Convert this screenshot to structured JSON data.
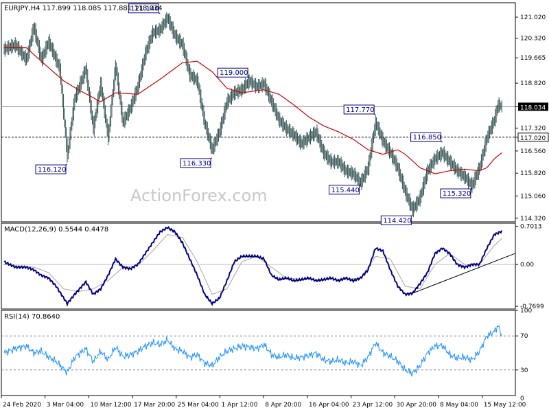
{
  "header": {
    "symbol_line": "EURJPY,H4  117.899 118.085 117.881 118.034",
    "macd_line": "MACD(12,26,9) 0.5544 0.4478",
    "rsi_line": "RSI(14) 70.8640"
  },
  "watermark": "ActionForex.com",
  "colors": {
    "candles": "#2f4f4f",
    "moving_average": "#cc0000",
    "macd": "#000080",
    "signal": "#b0a0a0",
    "rsi": "#1e90ff",
    "last_price_box": "#000000"
  },
  "chart_data": [
    {
      "type": "candlestick",
      "panel": "price",
      "ylim": [
        114.2,
        121.5
      ],
      "yticks": [
        "121.020",
        "120.320",
        "119.665",
        "118.820",
        "118.034",
        "117.320",
        "117.020",
        "116.560",
        "115.820",
        "115.060",
        "114.320"
      ],
      "x_labels": [
        "24 Feb 2020",
        "3 Mar 04:00",
        "10 Mar 12:00",
        "17 Mar 20:00",
        "25 Mar 04:00",
        "1 Apr 12:00",
        "8 Apr 20:00",
        "16 Apr 04:00",
        "23 Apr 12:00",
        "30 Apr 20:00",
        "8 May 04:00",
        "15 May 12:00"
      ],
      "close_path": [
        [
          0,
          119.95
        ],
        [
          3,
          120.1
        ],
        [
          6,
          119.6
        ],
        [
          8,
          120.7
        ],
        [
          10,
          119.6
        ],
        [
          12,
          120.2
        ],
        [
          15,
          119.3
        ],
        [
          17,
          116.4
        ],
        [
          19,
          118.3
        ],
        [
          22,
          119.3
        ],
        [
          24,
          117.3
        ],
        [
          26,
          118.8
        ],
        [
          28,
          117.0
        ],
        [
          30,
          119.4
        ],
        [
          32,
          117.5
        ],
        [
          34,
          118.0
        ],
        [
          36,
          118.7
        ],
        [
          38,
          119.8
        ],
        [
          40,
          120.5
        ],
        [
          42,
          120.6
        ],
        [
          44,
          121.0
        ],
        [
          46,
          120.4
        ],
        [
          48,
          120.1
        ],
        [
          50,
          119.1
        ],
        [
          52,
          118.9
        ],
        [
          54,
          117.5
        ],
        [
          56,
          116.6
        ],
        [
          58,
          117.2
        ],
        [
          60,
          118.2
        ],
        [
          62,
          118.5
        ],
        [
          64,
          118.6
        ],
        [
          66,
          118.9
        ],
        [
          68,
          118.7
        ],
        [
          70,
          118.8
        ],
        [
          72,
          118.2
        ],
        [
          74,
          117.6
        ],
        [
          76,
          117.3
        ],
        [
          78,
          117.1
        ],
        [
          80,
          116.8
        ],
        [
          82,
          117.0
        ],
        [
          84,
          117.2
        ],
        [
          86,
          116.5
        ],
        [
          88,
          116.2
        ],
        [
          90,
          116.2
        ],
        [
          92,
          115.9
        ],
        [
          94,
          115.8
        ],
        [
          96,
          115.5
        ],
        [
          98,
          116.0
        ],
        [
          100,
          117.5
        ],
        [
          102,
          116.9
        ],
        [
          104,
          116.5
        ],
        [
          106,
          116.0
        ],
        [
          108,
          115.2
        ],
        [
          110,
          114.6
        ],
        [
          112,
          115.0
        ],
        [
          114,
          115.9
        ],
        [
          116,
          116.3
        ],
        [
          118,
          116.5
        ],
        [
          120,
          116.2
        ],
        [
          122,
          115.9
        ],
        [
          124,
          115.7
        ],
        [
          126,
          115.4
        ],
        [
          128,
          116.0
        ],
        [
          130,
          117.0
        ],
        [
          132,
          117.6
        ],
        [
          133,
          118.1
        ],
        [
          134,
          118.034
        ]
      ],
      "moving_average": [
        [
          0,
          120.0
        ],
        [
          6,
          120.0
        ],
        [
          10,
          119.55
        ],
        [
          16,
          118.9
        ],
        [
          20,
          118.6
        ],
        [
          26,
          118.2
        ],
        [
          30,
          118.5
        ],
        [
          36,
          118.45
        ],
        [
          42,
          118.95
        ],
        [
          48,
          119.5
        ],
        [
          52,
          119.55
        ],
        [
          56,
          119.2
        ],
        [
          60,
          118.65
        ],
        [
          64,
          118.5
        ],
        [
          70,
          118.6
        ],
        [
          74,
          118.45
        ],
        [
          78,
          118.1
        ],
        [
          82,
          117.7
        ],
        [
          86,
          117.4
        ],
        [
          90,
          117.2
        ],
        [
          94,
          116.95
        ],
        [
          98,
          116.6
        ],
        [
          102,
          116.45
        ],
        [
          106,
          116.6
        ],
        [
          108,
          116.45
        ],
        [
          112,
          116.0
        ],
        [
          116,
          115.8
        ],
        [
          120,
          115.9
        ],
        [
          124,
          115.95
        ],
        [
          128,
          115.9
        ],
        [
          130,
          116.0
        ],
        [
          132,
          116.3
        ],
        [
          134,
          116.5
        ]
      ],
      "levels": [
        {
          "value": 117.02,
          "style": "dashed",
          "label": "117.020"
        },
        {
          "value": 118.034,
          "style": "solid",
          "label": "118.034"
        }
      ],
      "annotations": [
        {
          "label": "121.140",
          "x": 42,
          "y": 121.14
        },
        {
          "label": "116.120",
          "x": 17,
          "y": 116.12
        },
        {
          "label": "119.000",
          "x": 66,
          "y": 119.0
        },
        {
          "label": "116.330",
          "x": 56,
          "y": 116.33
        },
        {
          "label": "117.770",
          "x": 100,
          "y": 117.77
        },
        {
          "label": "115.440",
          "x": 96,
          "y": 115.44
        },
        {
          "label": "116.850",
          "x": 118,
          "y": 116.85
        },
        {
          "label": "114.420",
          "x": 110,
          "y": 114.42
        },
        {
          "label": "115.320",
          "x": 126,
          "y": 115.32
        }
      ]
    },
    {
      "type": "line",
      "panel": "macd",
      "ylim": [
        -0.82,
        0.76
      ],
      "yticks": [
        "0.7013",
        "0.00",
        "-0.7699"
      ],
      "series": [
        {
          "values": [
            [
              0,
              0.05
            ],
            [
              3,
              -0.05
            ],
            [
              6,
              -0.05
            ],
            [
              8,
              -0.1
            ],
            [
              10,
              -0.2
            ],
            [
              12,
              -0.25
            ],
            [
              14,
              -0.4
            ],
            [
              17,
              -0.72
            ],
            [
              19,
              -0.55
            ],
            [
              22,
              -0.32
            ],
            [
              24,
              -0.55
            ],
            [
              26,
              -0.45
            ],
            [
              28,
              -0.2
            ],
            [
              30,
              0.1
            ],
            [
              32,
              -0.05
            ],
            [
              34,
              -0.08
            ],
            [
              36,
              0.0
            ],
            [
              38,
              0.2
            ],
            [
              40,
              0.4
            ],
            [
              42,
              0.6
            ],
            [
              44,
              0.68
            ],
            [
              46,
              0.6
            ],
            [
              48,
              0.4
            ],
            [
              50,
              0.1
            ],
            [
              52,
              -0.2
            ],
            [
              54,
              -0.55
            ],
            [
              56,
              -0.72
            ],
            [
              58,
              -0.62
            ],
            [
              60,
              -0.3
            ],
            [
              62,
              0.05
            ],
            [
              64,
              0.15
            ],
            [
              66,
              0.15
            ],
            [
              68,
              0.15
            ],
            [
              70,
              0.1
            ],
            [
              72,
              -0.2
            ],
            [
              74,
              -0.28
            ],
            [
              76,
              -0.25
            ],
            [
              78,
              -0.3
            ],
            [
              80,
              -0.28
            ],
            [
              82,
              -0.25
            ],
            [
              84,
              -0.3
            ],
            [
              86,
              -0.28
            ],
            [
              88,
              -0.25
            ],
            [
              90,
              -0.3
            ],
            [
              92,
              -0.25
            ],
            [
              94,
              -0.3
            ],
            [
              96,
              -0.25
            ],
            [
              98,
              -0.1
            ],
            [
              100,
              0.3
            ],
            [
              102,
              0.25
            ],
            [
              104,
              -0.1
            ],
            [
              106,
              -0.4
            ],
            [
              108,
              -0.55
            ],
            [
              110,
              -0.53
            ],
            [
              112,
              -0.35
            ],
            [
              114,
              -0.15
            ],
            [
              116,
              0.2
            ],
            [
              118,
              0.3
            ],
            [
              120,
              0.2
            ],
            [
              122,
              0.0
            ],
            [
              124,
              -0.05
            ],
            [
              126,
              0.0
            ],
            [
              128,
              0.0
            ],
            [
              130,
              0.3
            ],
            [
              132,
              0.55
            ],
            [
              134,
              0.61
            ]
          ]
        }
      ],
      "signal": [
        [
          0,
          0.0
        ],
        [
          4,
          -0.03
        ],
        [
          8,
          -0.05
        ],
        [
          12,
          -0.15
        ],
        [
          16,
          -0.45
        ],
        [
          20,
          -0.5
        ],
        [
          24,
          -0.45
        ],
        [
          28,
          -0.3
        ],
        [
          32,
          -0.05
        ],
        [
          36,
          -0.02
        ],
        [
          40,
          0.25
        ],
        [
          44,
          0.55
        ],
        [
          48,
          0.5
        ],
        [
          52,
          0.05
        ],
        [
          56,
          -0.55
        ],
        [
          60,
          -0.45
        ],
        [
          64,
          0.05
        ],
        [
          68,
          0.15
        ],
        [
          72,
          -0.05
        ],
        [
          76,
          -0.25
        ],
        [
          80,
          -0.27
        ],
        [
          84,
          -0.28
        ],
        [
          88,
          -0.27
        ],
        [
          92,
          -0.27
        ],
        [
          96,
          -0.25
        ],
        [
          100,
          0.15
        ],
        [
          104,
          0.1
        ],
        [
          108,
          -0.4
        ],
        [
          112,
          -0.45
        ],
        [
          116,
          0.0
        ],
        [
          120,
          0.2
        ],
        [
          124,
          0.0
        ],
        [
          128,
          0.0
        ],
        [
          132,
          0.35
        ],
        [
          134,
          0.48
        ]
      ],
      "trendline": [
        [
          110,
          -0.53
        ],
        [
          136,
          0.2
        ]
      ]
    },
    {
      "type": "line",
      "panel": "rsi",
      "ylim": [
        0,
        100
      ],
      "yticks": [
        "100",
        "70",
        "30",
        "0"
      ],
      "levels": [
        70,
        30
      ],
      "series": [
        {
          "values": [
            [
              0,
              50
            ],
            [
              3,
              55
            ],
            [
              6,
              58
            ],
            [
              8,
              50
            ],
            [
              10,
              52
            ],
            [
              12,
              45
            ],
            [
              14,
              40
            ],
            [
              17,
              27
            ],
            [
              19,
              45
            ],
            [
              22,
              55
            ],
            [
              24,
              40
            ],
            [
              26,
              52
            ],
            [
              28,
              42
            ],
            [
              30,
              57
            ],
            [
              32,
              46
            ],
            [
              34,
              48
            ],
            [
              36,
              52
            ],
            [
              38,
              58
            ],
            [
              40,
              62
            ],
            [
              42,
              60
            ],
            [
              44,
              65
            ],
            [
              46,
              55
            ],
            [
              48,
              52
            ],
            [
              50,
              45
            ],
            [
              52,
              48
            ],
            [
              54,
              38
            ],
            [
              56,
              35
            ],
            [
              58,
              45
            ],
            [
              60,
              52
            ],
            [
              62,
              55
            ],
            [
              64,
              58
            ],
            [
              66,
              57
            ],
            [
              68,
              55
            ],
            [
              70,
              60
            ],
            [
              72,
              48
            ],
            [
              74,
              45
            ],
            [
              76,
              48
            ],
            [
              78,
              44
            ],
            [
              80,
              45
            ],
            [
              82,
              47
            ],
            [
              84,
              50
            ],
            [
              86,
              42
            ],
            [
              88,
              40
            ],
            [
              90,
              42
            ],
            [
              92,
              38
            ],
            [
              94,
              40
            ],
            [
              96,
              35
            ],
            [
              98,
              45
            ],
            [
              100,
              62
            ],
            [
              102,
              50
            ],
            [
              104,
              46
            ],
            [
              106,
              40
            ],
            [
              108,
              30
            ],
            [
              110,
              26
            ],
            [
              112,
              35
            ],
            [
              114,
              50
            ],
            [
              116,
              58
            ],
            [
              118,
              59
            ],
            [
              120,
              48
            ],
            [
              122,
              44
            ],
            [
              124,
              45
            ],
            [
              126,
              42
            ],
            [
              128,
              52
            ],
            [
              130,
              70
            ],
            [
              132,
              75
            ],
            [
              133,
              82
            ],
            [
              134,
              70.864
            ]
          ]
        }
      ]
    }
  ]
}
